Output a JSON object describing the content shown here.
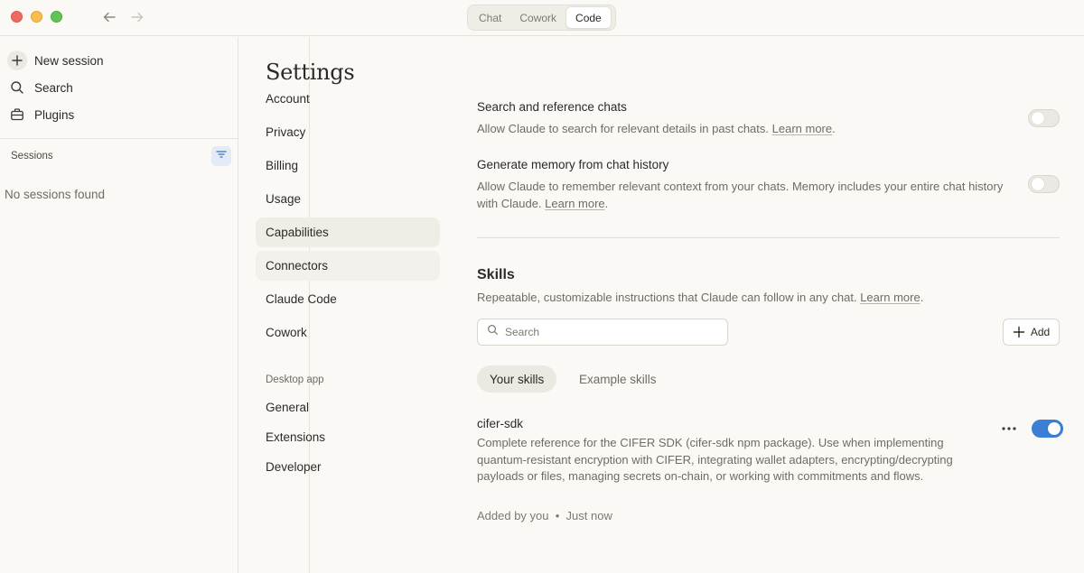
{
  "titlebar": {
    "tabs": [
      "Chat",
      "Cowork",
      "Code"
    ],
    "active_tab": "Code"
  },
  "sidebar": {
    "new_session": "New session",
    "search": "Search",
    "plugins": "Plugins",
    "sessions_label": "Sessions",
    "empty_text": "No sessions found"
  },
  "settings": {
    "title": "Settings",
    "nav": [
      "Account",
      "Privacy",
      "Billing",
      "Usage",
      "Capabilities",
      "Connectors",
      "Claude Code",
      "Cowork"
    ],
    "active_nav": "Capabilities",
    "desktop_section": "Desktop app",
    "desktop_nav": [
      "General",
      "Extensions",
      "Developer"
    ]
  },
  "content": {
    "search_chats": {
      "title": "Search and reference chats",
      "desc": "Allow Claude to search for relevant details in past chats.",
      "link": "Learn more",
      "enabled": false
    },
    "memory": {
      "title": "Generate memory from chat history",
      "desc": "Allow Claude to remember relevant context from your chats. Memory includes your entire chat history with Claude.",
      "link": "Learn more",
      "enabled": false
    },
    "skills": {
      "heading": "Skills",
      "desc": "Repeatable, customizable instructions that Claude can follow in any chat.",
      "link": "Learn more",
      "search_placeholder": "Search",
      "add_label": "Add",
      "tabs": [
        "Your skills",
        "Example skills"
      ],
      "items": [
        {
          "name": "cifer-sdk",
          "desc": "Complete reference for the CIFER SDK (cifer-sdk npm package). Use when implementing quantum-resistant encryption with CIFER, integrating wallet adapters, encrypting/decrypting payloads or files, managing secrets on-chain, or working with commitments and flows.",
          "added_by": "Added by you",
          "separator": "•",
          "when": "Just now",
          "enabled": true
        }
      ]
    }
  },
  "colors": {
    "background": "#faf9f5",
    "toggle_on": "#3b7ed6",
    "active_nav_bg": "#efede6"
  }
}
